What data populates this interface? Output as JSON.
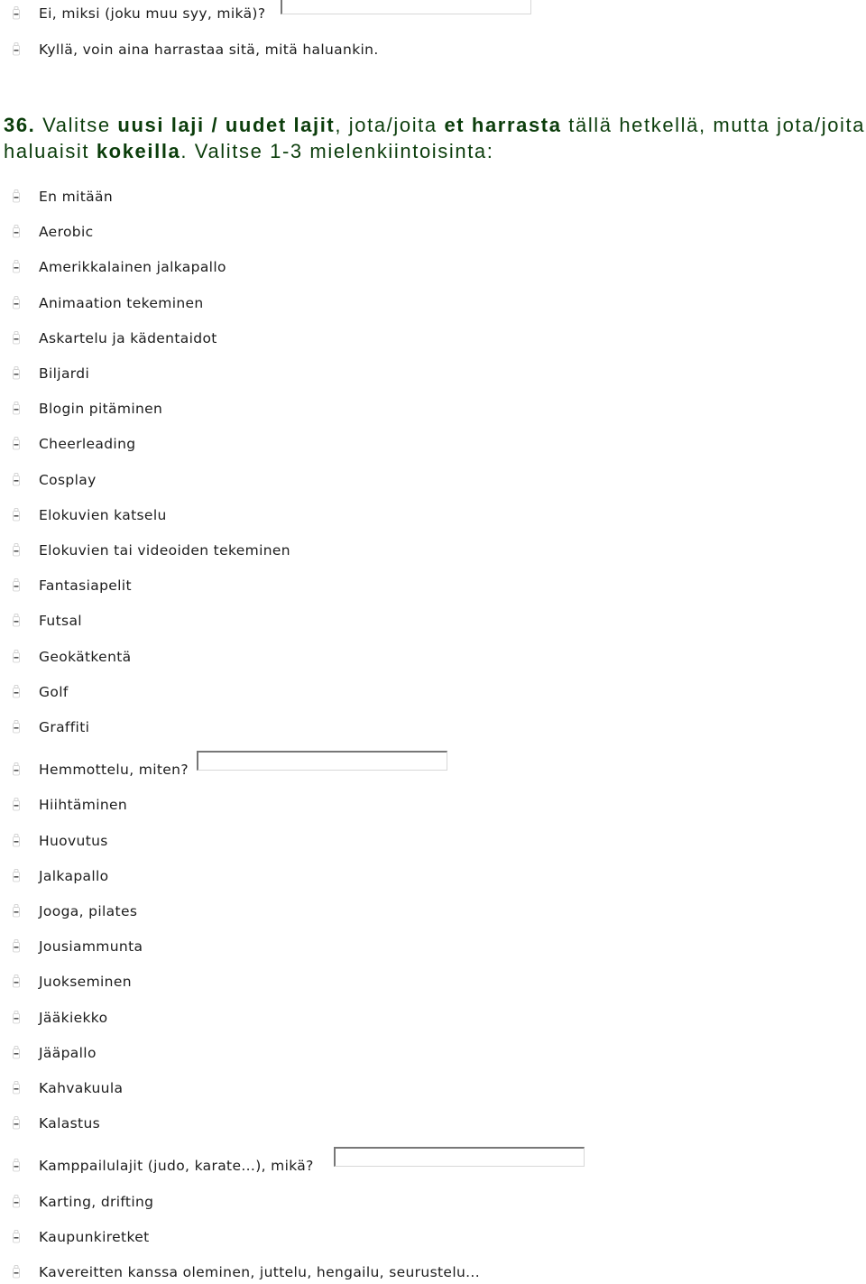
{
  "prev_options": [
    {
      "label": "Ei, miksi (joku muu syy, mikä)?",
      "has_text_input": true,
      "text_value": ""
    },
    {
      "label": "Kyllä, voin aina harrastaa sitä, mitä haluankin.",
      "has_text_input": false
    }
  ],
  "question": {
    "number": "36.",
    "parts": [
      {
        "text": "Valitse ",
        "bold": false
      },
      {
        "text": "uusi laji /  uudet lajit",
        "bold": true
      },
      {
        "text": ", jota/joita ",
        "bold": false
      },
      {
        "text": "et harrasta",
        "bold": true
      },
      {
        "text": " tällä hetkellä, mutta jota/joita haluaisit ",
        "bold": false
      },
      {
        "text": "kokeilla",
        "bold": true
      },
      {
        "text": ". Valitse 1-3 mielenkiintoisinta:",
        "bold": false
      }
    ],
    "color": "#0b3d0b"
  },
  "options": [
    {
      "label": "En mitään"
    },
    {
      "label": "Aerobic"
    },
    {
      "label": "Amerikkalainen jalkapallo"
    },
    {
      "label": "Animaation tekeminen"
    },
    {
      "label": "Askartelu ja kädentaidot"
    },
    {
      "label": "Biljardi"
    },
    {
      "label": "Blogin pitäminen"
    },
    {
      "label": "Cheerleading"
    },
    {
      "label": "Cosplay"
    },
    {
      "label": "Elokuvien katselu"
    },
    {
      "label": "Elokuvien tai videoiden tekeminen"
    },
    {
      "label": "Fantasiapelit"
    },
    {
      "label": "Futsal"
    },
    {
      "label": "Geokätkentä"
    },
    {
      "label": "Golf"
    },
    {
      "label": "Graffiti"
    },
    {
      "label": "Hemmottelu, miten?",
      "has_text_input": true,
      "text_value": ""
    },
    {
      "label": "Hiihtäminen"
    },
    {
      "label": "Huovutus"
    },
    {
      "label": "Jalkapallo"
    },
    {
      "label": "Jooga, pilates"
    },
    {
      "label": "Jousiammunta"
    },
    {
      "label": "Juokseminen"
    },
    {
      "label": "Jääkiekko"
    },
    {
      "label": "Jääpallo"
    },
    {
      "label": "Kahvakuula"
    },
    {
      "label": "Kalastus"
    },
    {
      "label": "Kamppailulajit (judo, karate...), mikä?",
      "has_text_input": true,
      "text_value": ""
    },
    {
      "label": "Karting, drifting"
    },
    {
      "label": "Kaupunkiretket"
    },
    {
      "label": "Kavereitten kanssa oleminen, juttelu, hengailu, seurustelu..."
    }
  ],
  "icons": {
    "option_marker": "radio-button-icon"
  }
}
